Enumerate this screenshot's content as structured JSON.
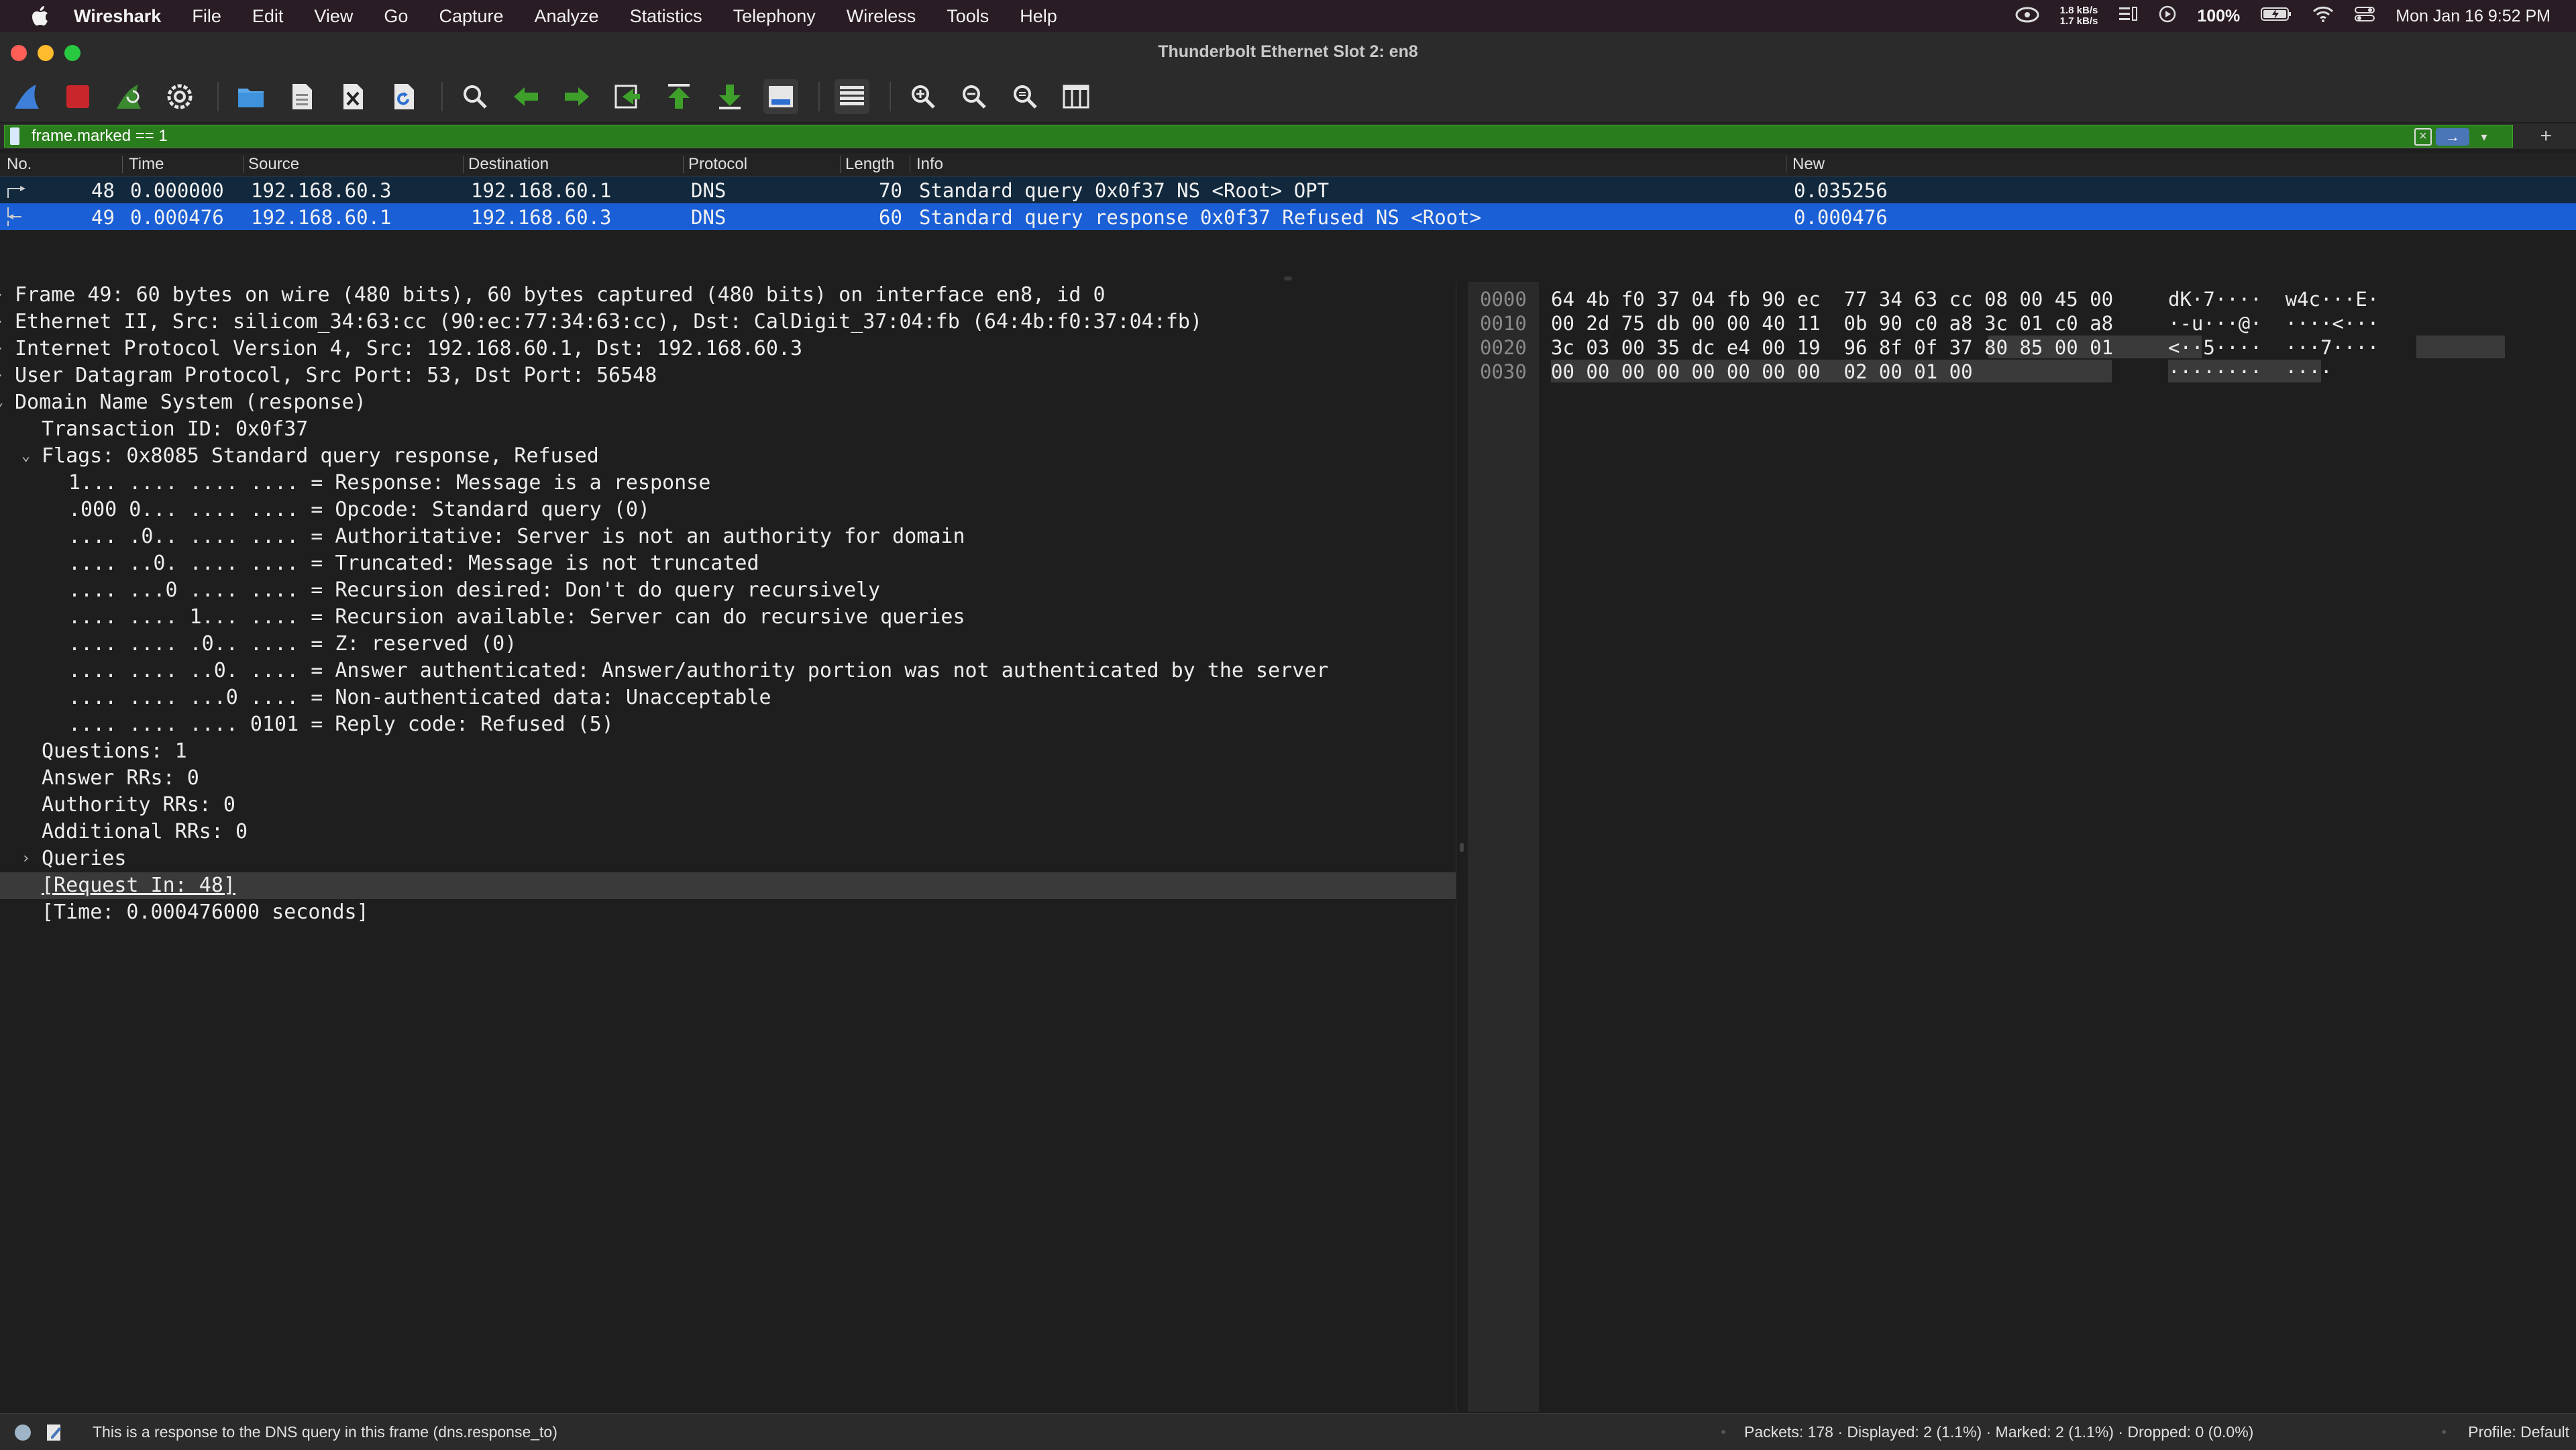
{
  "menubar": {
    "app_name": "Wireshark",
    "items": [
      "File",
      "Edit",
      "View",
      "Go",
      "Capture",
      "Analyze",
      "Statistics",
      "Telephony",
      "Wireless",
      "Tools",
      "Help"
    ],
    "net_up": "1.8 kB/s",
    "net_down": "1.7 kB/s",
    "battery": "100%",
    "datetime": "Mon Jan 16  9:52 PM"
  },
  "window": {
    "title": "Thunderbolt Ethernet Slot 2: en8"
  },
  "toolbar": {
    "icons": [
      "shark-fin-start-icon",
      "stop-capture-icon",
      "restart-capture-icon",
      "capture-options-icon",
      "open-file-icon",
      "save-file-icon",
      "close-file-icon",
      "reload-file-icon",
      "find-packet-icon",
      "go-back-icon",
      "go-forward-icon",
      "go-to-packet-icon",
      "first-packet-icon",
      "last-packet-icon",
      "autoscroll-icon",
      "colorize-icon",
      "zoom-in-icon",
      "zoom-out-icon",
      "normal-size-icon",
      "resize-columns-icon"
    ]
  },
  "filter": {
    "value": "frame.marked == 1"
  },
  "packet_list": {
    "columns": [
      "No.",
      "Time",
      "Source",
      "Destination",
      "Protocol",
      "Length",
      "Info",
      "New"
    ],
    "rows": [
      {
        "no": "48",
        "time": "0.000000",
        "source": "192.168.60.3",
        "destination": "192.168.60.1",
        "protocol": "DNS",
        "length": "70",
        "info": "Standard query 0x0f37 NS <Root> OPT",
        "new": "0.035256"
      },
      {
        "no": "49",
        "time": "0.000476",
        "source": "192.168.60.1",
        "destination": "192.168.60.3",
        "protocol": "DNS",
        "length": "60",
        "info": "Standard query response 0x0f37 Refused NS <Root>",
        "new": "0.000476"
      }
    ]
  },
  "details": {
    "lines": [
      {
        "indent": 0,
        "arrow": "›",
        "text": "Frame 49: 60 bytes on wire (480 bits), 60 bytes captured (480 bits) on interface en8, id 0"
      },
      {
        "indent": 0,
        "arrow": "›",
        "text": "Ethernet II, Src: silicom_34:63:cc (90:ec:77:34:63:cc), Dst: CalDigit_37:04:fb (64:4b:f0:37:04:fb)"
      },
      {
        "indent": 0,
        "arrow": "›",
        "text": "Internet Protocol Version 4, Src: 192.168.60.1, Dst: 192.168.60.3"
      },
      {
        "indent": 0,
        "arrow": "›",
        "text": "User Datagram Protocol, Src Port: 53, Dst Port: 56548"
      },
      {
        "indent": 0,
        "arrow": "⌄",
        "text": "Domain Name System (response)"
      },
      {
        "indent": 1,
        "arrow": "",
        "text": "Transaction ID: 0x0f37"
      },
      {
        "indent": 1,
        "arrow": "⌄",
        "text": "Flags: 0x8085 Standard query response, Refused"
      },
      {
        "indent": 2,
        "arrow": "",
        "text": "1... .... .... .... = Response: Message is a response"
      },
      {
        "indent": 2,
        "arrow": "",
        "text": ".000 0... .... .... = Opcode: Standard query (0)"
      },
      {
        "indent": 2,
        "arrow": "",
        "text": ".... .0.. .... .... = Authoritative: Server is not an authority for domain"
      },
      {
        "indent": 2,
        "arrow": "",
        "text": ".... ..0. .... .... = Truncated: Message is not truncated"
      },
      {
        "indent": 2,
        "arrow": "",
        "text": ".... ...0 .... .... = Recursion desired: Don't do query recursively"
      },
      {
        "indent": 2,
        "arrow": "",
        "text": ".... .... 1... .... = Recursion available: Server can do recursive queries"
      },
      {
        "indent": 2,
        "arrow": "",
        "text": ".... .... .0.. .... = Z: reserved (0)"
      },
      {
        "indent": 2,
        "arrow": "",
        "text": ".... .... ..0. .... = Answer authenticated: Answer/authority portion was not authenticated by the server"
      },
      {
        "indent": 2,
        "arrow": "",
        "text": ".... .... ...0 .... = Non-authenticated data: Unacceptable"
      },
      {
        "indent": 2,
        "arrow": "",
        "text": ".... .... .... 0101 = Reply code: Refused (5)"
      },
      {
        "indent": 1,
        "arrow": "",
        "text": "Questions: 1"
      },
      {
        "indent": 1,
        "arrow": "",
        "text": "Answer RRs: 0"
      },
      {
        "indent": 1,
        "arrow": "",
        "text": "Authority RRs: 0"
      },
      {
        "indent": 1,
        "arrow": "",
        "text": "Additional RRs: 0"
      },
      {
        "indent": 1,
        "arrow": "›",
        "text": "Queries"
      },
      {
        "indent": 1,
        "arrow": "",
        "text": "[Request In: 48]",
        "link": true,
        "highlight": true
      },
      {
        "indent": 1,
        "arrow": "",
        "text": "[Time: 0.000476000 seconds]"
      }
    ]
  },
  "bytes": {
    "rows": [
      {
        "offset": "0000",
        "hex": "64 4b f0 37 04 fb 90 ec  77 34 63 cc 08 00 45 00",
        "ascii": "dK·7····  w4c···E·"
      },
      {
        "offset": "0010",
        "hex": "00 2d 75 db 00 00 40 11  0b 90 c0 a8 3c 01 c0 a8",
        "ascii": "·-u···@·  ····<···"
      },
      {
        "offset": "0020",
        "hex": "3c 03 00 35 dc e4 00 19  96 8f 0f 37 80 85 00 01",
        "ascii": "<··5····  ···7····"
      },
      {
        "offset": "0030",
        "hex": "00 00 00 00 00 00 00 00  02 00 01 00",
        "ascii": "········  ····"
      }
    ]
  },
  "status": {
    "message": "This is a response to the DNS query in this frame (dns.response_to)",
    "stats": "Packets: 178 · Displayed: 2 (1.1%) · Marked: 2 (1.1%) · Dropped: 0 (0.0%)",
    "profile": "Profile: Default"
  },
  "colors": {
    "filter_valid": "#2a7d1c",
    "selected_row": "#1a5fd6",
    "background": "#1e1e1e"
  }
}
